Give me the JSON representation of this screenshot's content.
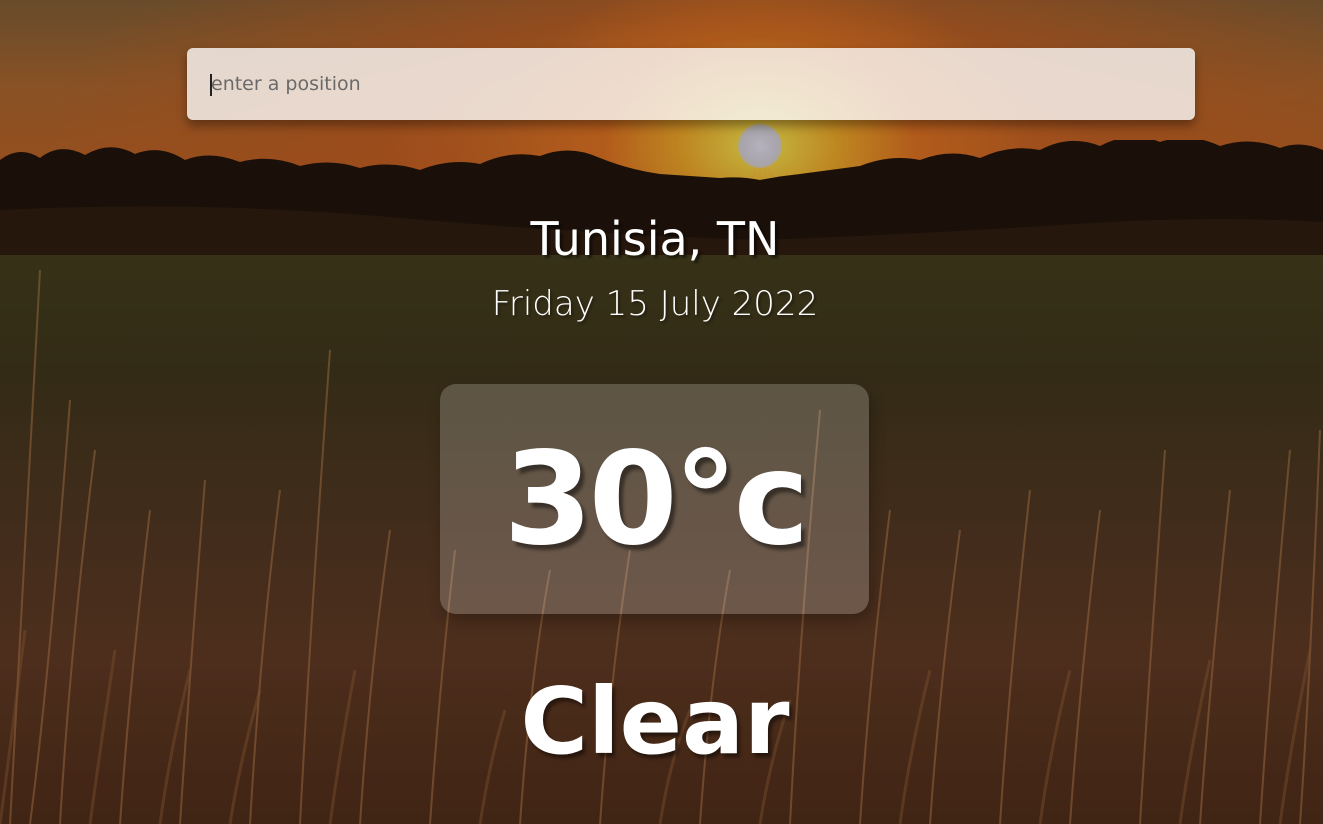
{
  "search": {
    "placeholder": "enter a position",
    "value": ""
  },
  "location": {
    "city": "Tunisia, TN"
  },
  "date": {
    "text": "Friday 15 July 2022"
  },
  "weather": {
    "temperature": "30°c",
    "condition": "Clear"
  },
  "background": {
    "scene": "sunset-field",
    "sun_color": "#e8e060",
    "sky_color": "#b45c22",
    "field_color": "#4a3420"
  },
  "colors": {
    "text": "#ffffff",
    "search_bg": "#ffffff",
    "placeholder": "#6a6a6a"
  }
}
